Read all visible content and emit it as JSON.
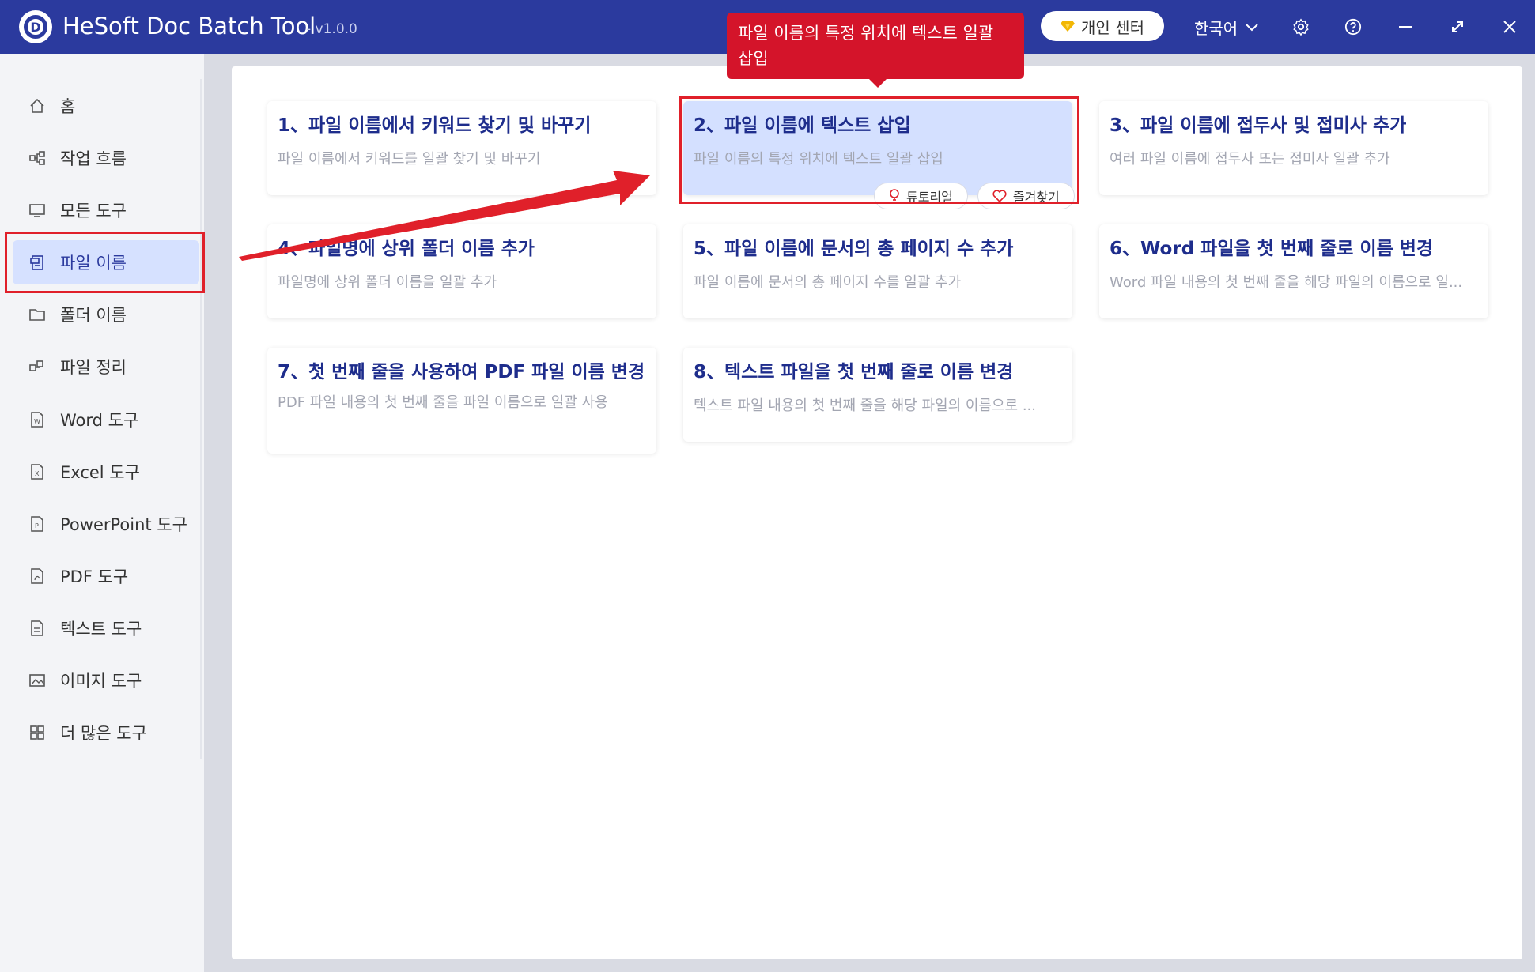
{
  "app": {
    "title": "HeSoft Doc Batch Tool",
    "version": "- v1.0.0",
    "logo_letter": "D"
  },
  "header": {
    "vip_label": "개인 센터",
    "language": "한국어"
  },
  "sidebar": {
    "items": [
      {
        "label": "홈",
        "icon": "home-icon"
      },
      {
        "label": "작업 흐름",
        "icon": "workflow-icon"
      },
      {
        "label": "모든 도구",
        "icon": "monitor-icon"
      },
      {
        "label": "파일 이름",
        "icon": "file-name-icon",
        "active": true
      },
      {
        "label": "폴더 이름",
        "icon": "folder-icon"
      },
      {
        "label": "파일 정리",
        "icon": "organize-icon"
      },
      {
        "label": "Word 도구",
        "icon": "word-icon"
      },
      {
        "label": "Excel 도구",
        "icon": "excel-icon"
      },
      {
        "label": "PowerPoint 도구",
        "icon": "powerpoint-icon"
      },
      {
        "label": "PDF 도구",
        "icon": "pdf-icon"
      },
      {
        "label": "텍스트 도구",
        "icon": "text-icon"
      },
      {
        "label": "이미지 도구",
        "icon": "image-icon"
      },
      {
        "label": "더 많은 도구",
        "icon": "grid-icon"
      }
    ]
  },
  "cards": [
    {
      "title": "1、파일 이름에서 키워드 찾기 및 바꾸기",
      "desc": "파일 이름에서 키워드를 일괄 찾기 및 바꾸기"
    },
    {
      "title": "2、파일 이름에 텍스트 삽입",
      "desc": "파일 이름의 특정 위치에 텍스트 일괄 삽입"
    },
    {
      "title": "3、파일 이름에 접두사 및 접미사 추가",
      "desc": "여러 파일 이름에 접두사 또는 접미사 일괄 추가"
    },
    {
      "title": "4、파일명에 상위 폴더 이름 추가",
      "desc": "파일명에 상위 폴더 이름을 일괄 추가"
    },
    {
      "title": "5、파일 이름에 문서의 총 페이지 수 추가",
      "desc": "파일 이름에 문서의 총 페이지 수를 일괄 추가"
    },
    {
      "title": "6、Word 파일을 첫 번째 줄로 이름 변경",
      "desc": "Word 파일 내용의 첫 번째 줄을 해당 파일의 이름으로 일..."
    },
    {
      "title": "7、첫 번째 줄을 사용하여 PDF 파일 이름 변경",
      "desc": "PDF 파일 내용의 첫 번째 줄을 파일 이름으로 일괄 사용"
    },
    {
      "title": "8、텍스트 파일을 첫 번째 줄로 이름 변경",
      "desc": "텍스트 파일 내용의 첫 번째 줄을 해당 파일의 이름으로 ..."
    }
  ],
  "card_actions": {
    "tutorial": "튜토리얼",
    "favorite": "즐겨찾기"
  },
  "tooltip": {
    "text": "파일 이름의 특정 위치에 텍스트 일괄 삽입"
  },
  "colors": {
    "titlebar": "#2b3a9e",
    "accent": "#1e2d8c",
    "highlight": "#e0202a",
    "active_bg": "#d6e1ff"
  }
}
